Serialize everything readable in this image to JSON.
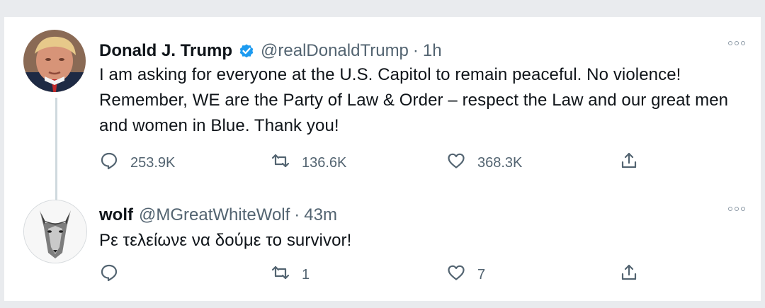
{
  "tweets": [
    {
      "name": "Donald J. Trump",
      "handle": "@realDonaldTrump",
      "separator": "·",
      "time": "1h",
      "text": "I am asking for everyone at the U.S. Capitol to remain peaceful. No violence! Remember, WE are the Party of Law & Order – respect the Law and our great men and women in Blue. Thank you!",
      "replies": "253.9K",
      "retweets": "136.6K",
      "likes": "368.3K",
      "verified": true
    },
    {
      "name": "wolf",
      "handle": "@MGreatWhiteWolf",
      "separator": "·",
      "time": "43m",
      "text": "Ρε τελείωνε να δούμε το survivor!",
      "replies": "",
      "retweets": "1",
      "likes": "7",
      "verified": false
    }
  ],
  "colors": {
    "verified_blue": "#1d9bf0",
    "secondary_text": "#536471",
    "thread_line": "#cfd9de"
  },
  "icons": [
    "reply-icon",
    "retweet-icon",
    "like-icon",
    "share-icon",
    "more-icon",
    "verified-badge-icon"
  ]
}
